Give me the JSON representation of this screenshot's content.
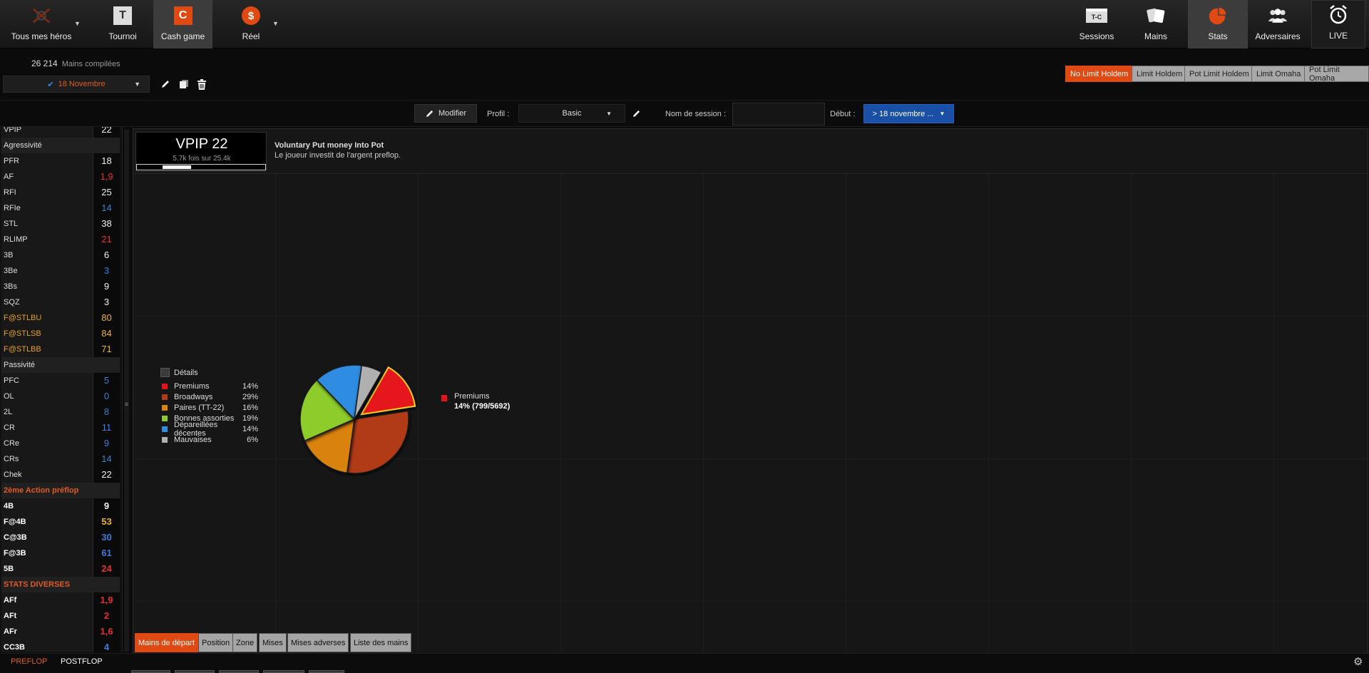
{
  "nav": {
    "heroes": "Tous mes héros",
    "tournoi": "Tournoi",
    "tournoi_icon_letter": "T",
    "cash_game": "Cash game",
    "cash_game_icon_letter": "C",
    "reel": "Réel",
    "reel_icon_letter": "$",
    "sessions": "Sessions",
    "sessions_icon_text": "T-C",
    "mains": "Mains",
    "stats": "Stats",
    "adversaires": "Adversaires",
    "live": "LIVE",
    "accent": "#e04a12"
  },
  "header": {
    "hands_count": "26 214",
    "hands_label": "Mains compilées",
    "date_filter": "18 Novembre"
  },
  "game_tabs": [
    {
      "label": "No Limit Holdem"
    },
    {
      "label": "Limit Holdem"
    },
    {
      "label": "Pot Limit Holdem"
    },
    {
      "label": "Limit Omaha"
    },
    {
      "label": "Pot Limit Omaha"
    }
  ],
  "filters": {
    "modifier": "Modifier",
    "profile_label": "Profil :",
    "profile_value": "Basic",
    "session_label": "Nom de session :",
    "session_value": "",
    "debut_label": "Début :",
    "debut_value": "> 18 novembre ..."
  },
  "stats_rows": [
    {
      "name": "VPIP",
      "value": "22",
      "color": "w"
    },
    {
      "section": "Agressivité"
    },
    {
      "name": "PFR",
      "value": "18",
      "color": "w"
    },
    {
      "name": "AF",
      "value": "1,9",
      "color": "r"
    },
    {
      "name": "RFI",
      "value": "25",
      "color": "w"
    },
    {
      "name": "RFIe",
      "value": "14",
      "color": "b"
    },
    {
      "name": "STL",
      "value": "38",
      "color": "w"
    },
    {
      "name": "RLIMP",
      "value": "21",
      "color": "r"
    },
    {
      "name": "3B",
      "value": "6",
      "color": "w"
    },
    {
      "name": "3Be",
      "value": "3",
      "color": "b"
    },
    {
      "name": "3Bs",
      "value": "9",
      "color": "w"
    },
    {
      "name": "SQZ",
      "value": "3",
      "color": "w"
    },
    {
      "name": "F@STLBU",
      "value": "80",
      "color": "o",
      "orange": true
    },
    {
      "name": "F@STLSB",
      "value": "84",
      "color": "o",
      "orange": true
    },
    {
      "name": "F@STLBB",
      "value": "71",
      "color": "o",
      "orange": true
    },
    {
      "section": "Passivité"
    },
    {
      "name": "PFC",
      "value": "5",
      "color": "b"
    },
    {
      "name": "OL",
      "value": "0",
      "color": "b"
    },
    {
      "name": "2L",
      "value": "8",
      "color": "b"
    },
    {
      "name": "CR",
      "value": "11",
      "color": "b"
    },
    {
      "name": "CRe",
      "value": "9",
      "color": "b"
    },
    {
      "name": "CRs",
      "value": "14",
      "color": "b"
    },
    {
      "name": "Chek",
      "value": "22",
      "color": "w"
    },
    {
      "section": "2ème Action préflop",
      "orange": true
    },
    {
      "name": "4B",
      "value": "9",
      "color": "w",
      "bold": true
    },
    {
      "name": "F@4B",
      "value": "53",
      "color": "o",
      "bold": true
    },
    {
      "name": "C@3B",
      "value": "30",
      "color": "b",
      "bold": true
    },
    {
      "name": "F@3B",
      "value": "61",
      "color": "b",
      "bold": true
    },
    {
      "name": "5B",
      "value": "24",
      "color": "r",
      "bold": true
    },
    {
      "section": "STATS DIVERSES",
      "orange": true
    },
    {
      "name": "AFf",
      "value": "1,9",
      "color": "r",
      "bold": true
    },
    {
      "name": "AFt",
      "value": "2",
      "color": "r",
      "bold": true
    },
    {
      "name": "AFr",
      "value": "1,6",
      "color": "r",
      "bold": true
    },
    {
      "name": "CC3B",
      "value": "4",
      "color": "b",
      "bold": true
    }
  ],
  "stat_detail": {
    "title": "VPIP 22",
    "sub": "5.7k fois sur 25.4k",
    "bar_value": 0.22,
    "fullname": "Voluntary Put money Into Pot",
    "description": "Le joueur investit de l'argent preflop."
  },
  "chart_data": {
    "type": "pie",
    "details_label": "Détails",
    "slices": [
      {
        "label": "Premiums",
        "value": 14,
        "pct_label": "14%",
        "color": "#e5121b",
        "exploded": true
      },
      {
        "label": "Broadways",
        "value": 29,
        "pct_label": "29%",
        "color": "#b13a12"
      },
      {
        "label": "Paires (TT-22)",
        "value": 16,
        "pct_label": "16%",
        "color": "#d9820f"
      },
      {
        "label": "Bonnes assorties",
        "value": 19,
        "pct_label": "19%",
        "color": "#8dcc2a"
      },
      {
        "label": "Dépareillées décentes",
        "value": 14,
        "pct_label": "14%",
        "color": "#2f8de0"
      },
      {
        "label": "Mauvaises",
        "value": 6,
        "pct_label": "6%",
        "color": "#b0b0b0"
      }
    ],
    "selected": {
      "label": "Premiums",
      "value": "14% (799/5692)"
    }
  },
  "bottom_tabs": [
    {
      "label": "Mains de départ"
    },
    {
      "label": "Position"
    },
    {
      "label": "Zone"
    },
    {
      "label": "Mises"
    },
    {
      "label": "Mises adverses"
    },
    {
      "label": "Liste des mains"
    }
  ],
  "modes": {
    "preflop": "PREFLOP",
    "postflop": "POSTFLOP"
  }
}
